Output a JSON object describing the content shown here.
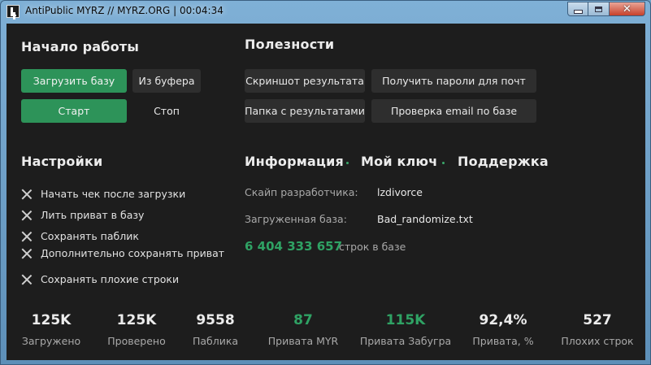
{
  "window": {
    "title": "AntiPublic MYRZ // MYRZ.ORG | 00:04:34",
    "close_glyph": "✕"
  },
  "start": {
    "heading": "Начало работы",
    "load_db": "Загрузить базу",
    "from_clipboard": "Из буфера",
    "start": "Старт",
    "stop": "Стоп"
  },
  "useful": {
    "heading": "Полезности",
    "screenshot": "Скриншот результата",
    "get_passwords": "Получить пароли для почт",
    "results_folder": "Папка с результатами",
    "check_email": "Проверка email по базе"
  },
  "settings": {
    "heading": "Настройки",
    "options": [
      "Начать чек после загрузки",
      "Лить приват в базу",
      "Сохранять паблик",
      "Дополнительно сохранять приват",
      "Сохранять плохие строки"
    ]
  },
  "info": {
    "tab_info": "Информация",
    "tab_key": "Мой ключ",
    "tab_support": "Поддержка",
    "skype_label": "Скайп разработчика:",
    "skype_value": "lzdivorce",
    "db_label": "Загруженная база:",
    "db_value": "Bad_randomize.txt",
    "lines_count": "6 404 333 657",
    "lines_label": "строк в базе"
  },
  "stats": [
    {
      "value": "125K",
      "label": "Загружено",
      "accent": false
    },
    {
      "value": "125K",
      "label": "Проверено",
      "accent": false
    },
    {
      "value": "9558",
      "label": "Паблика",
      "accent": false
    },
    {
      "value": "87",
      "label": "Привата MYR",
      "accent": true
    },
    {
      "value": "115K",
      "label": "Привата Забугра",
      "accent": true
    },
    {
      "value": "92,4%",
      "label": "Привата, %",
      "accent": false
    },
    {
      "value": "527",
      "label": "Плохих строк",
      "accent": false
    }
  ],
  "colors": {
    "accent_green": "#2d9359",
    "background": "#1d1d1d",
    "button_gray": "#2e2e2e"
  }
}
